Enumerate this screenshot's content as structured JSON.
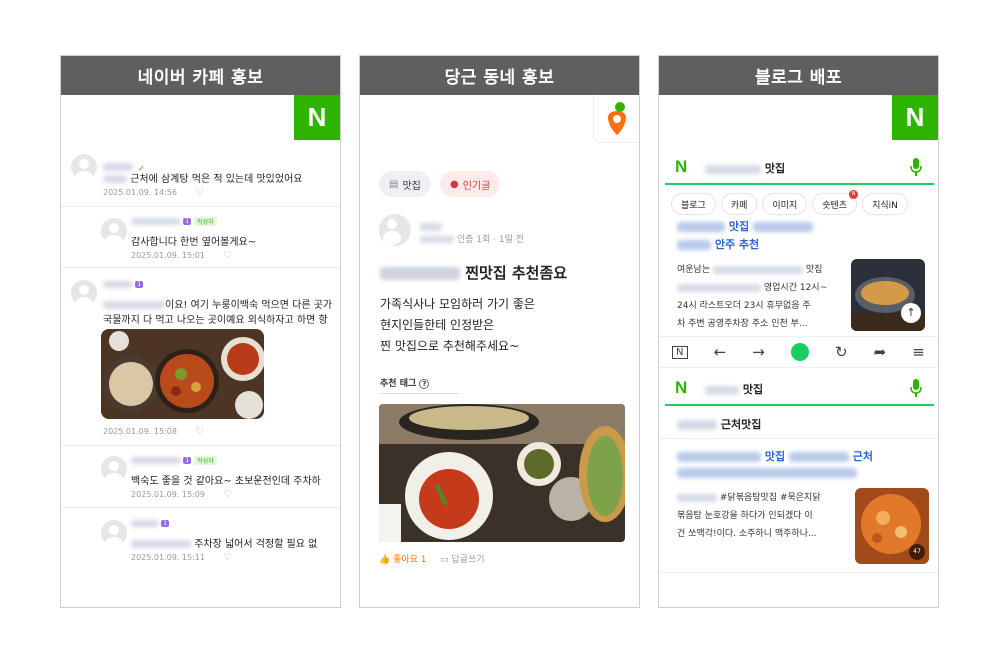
{
  "panels": [
    {
      "header": "네이버 카페 홍보",
      "logo": "N"
    },
    {
      "header": "당근 동네 홍보"
    },
    {
      "header": "블로그 배포",
      "logo": "N"
    }
  ],
  "cafe": {
    "comments": [
      {
        "text": "근처에 삼계탕 먹은 적 있는데 맛있었어요",
        "time": "2025.01.09. 14:56"
      },
      {
        "text": "감사합니다 한번 옆어볼게요~",
        "time": "2025.01.09. 15:01",
        "badge": "1",
        "tag": "작성자"
      },
      {
        "text_line1": "이요! 여기 누룽이백숙 먹으면 다른 곳가",
        "text_line2": "국물까지 다 먹고 나오는 곳이예요 외식하자고 하면 항",
        "time": "2025.01.09. 15:08",
        "badge": "1"
      },
      {
        "text": "백숙도 좋을 것 같아요~ 초보운전인데 주차하",
        "time": "2025.01.09. 15:09",
        "badge": "1",
        "tag": "작성자"
      },
      {
        "text": "주차장 넓어서 걱정할 필요 없",
        "time": "2025.01.09. 15:11",
        "badge": "1"
      }
    ]
  },
  "daangn": {
    "chips": [
      "맛집",
      "인기글"
    ],
    "meta": "인증 1회 · 1일 전",
    "title": "찐맛집 추천좀요",
    "body": [
      "가족식사나 모임하러 가기 좋은",
      "현지인들한테 인정받은",
      "찐 맛집으로 추천해주세요~"
    ],
    "tags_label": "추천 태그",
    "like": "좋아요 1",
    "reply": "답글쓰기"
  },
  "blog": {
    "search1": "맛집",
    "tabs": [
      "블로그",
      "카페",
      "이미지",
      "숏텐츠",
      "지식iN"
    ],
    "result_title_a": "맛집",
    "result_title_b": "안주 추천",
    "snippet1_a": "여운남는",
    "snippet1_b": "맛집",
    "snippet2": "영업시간 12시~",
    "snippet3": "24시 라스트오더 23시 휴무없음 주",
    "snippet4": "차 주변 공영주차장 주소 인천 부...",
    "search2": "맛집",
    "section_title": "근처맛집",
    "result2_a": "맛집",
    "result2_b": "근처",
    "snippet5": "#닭볶음탕맛집 #묵은지닭",
    "snippet6": "볶음탕 눈호강을 하다가 인되겠다 이",
    "snippet7": "건 쏘맥각!이다. 소주하니 맥주하나...",
    "thumb_count": "47",
    "new_dot": "N"
  }
}
